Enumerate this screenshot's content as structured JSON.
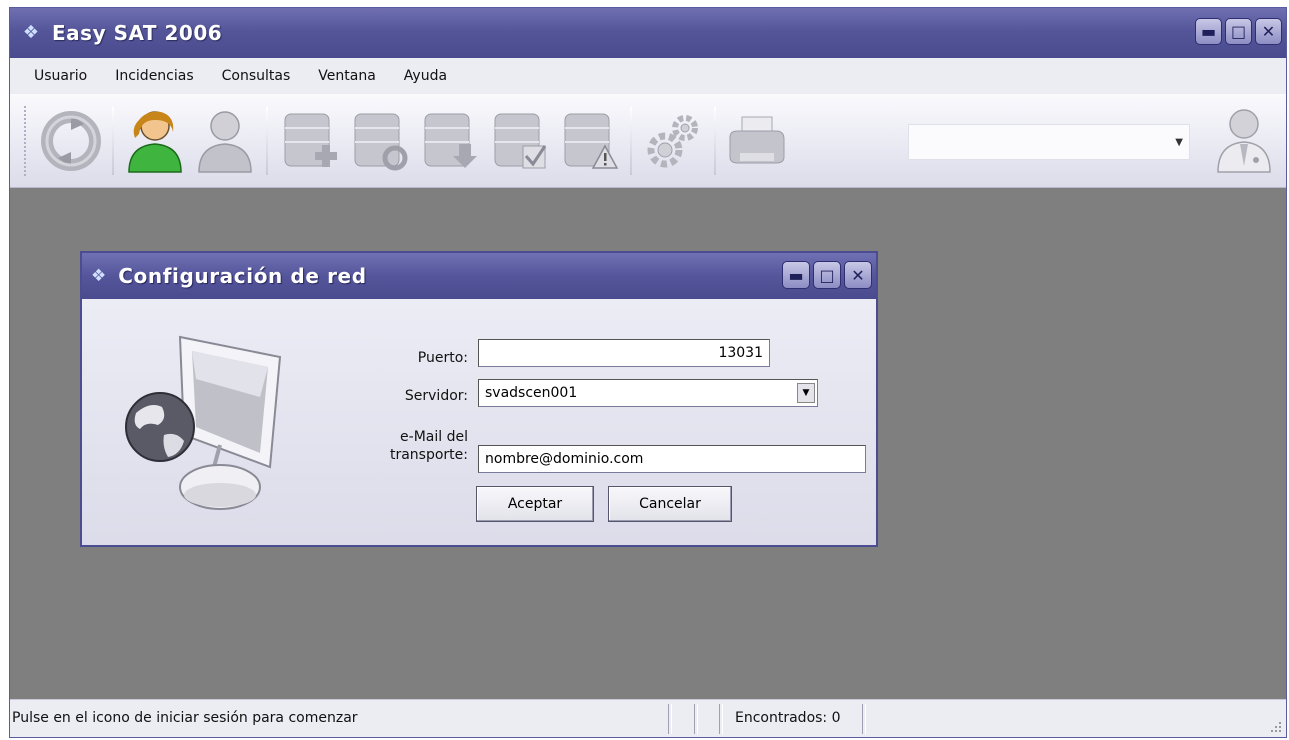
{
  "window": {
    "title": "Easy SAT 2006",
    "icon": "app-logo-icon"
  },
  "menu": {
    "items": [
      "Usuario",
      "Incidencias",
      "Consultas",
      "Ventana",
      "Ayuda"
    ]
  },
  "toolbar": {
    "buttons": [
      {
        "name": "refresh-icon"
      },
      {
        "name": "login-user-icon"
      },
      {
        "name": "logout-user-icon"
      },
      {
        "name": "db-add-icon"
      },
      {
        "name": "db-sync-icon"
      },
      {
        "name": "db-download-icon"
      },
      {
        "name": "db-check-icon"
      },
      {
        "name": "db-warning-icon"
      },
      {
        "name": "settings-gears-icon"
      },
      {
        "name": "printer-icon"
      }
    ],
    "combo_value": "",
    "right_icon": "doctor-user-icon"
  },
  "dialog": {
    "title": "Configuración de red",
    "port_label": "Puerto:",
    "port_value": "13031",
    "server_label": "Servidor:",
    "server_value": "svadscen001",
    "email_label_1": "e-Mail del",
    "email_label_2": "transporte:",
    "email_value": "nombre@dominio.com",
    "accept_label": "Aceptar",
    "cancel_label": "Cancelar"
  },
  "status": {
    "message": "Pulse en el icono de iniciar sesión para comenzar",
    "found": "Encontrados: 0"
  },
  "colors": {
    "titlebar": "#55559a",
    "workspace": "#7f7f7f",
    "menubar": "#ececf3"
  }
}
